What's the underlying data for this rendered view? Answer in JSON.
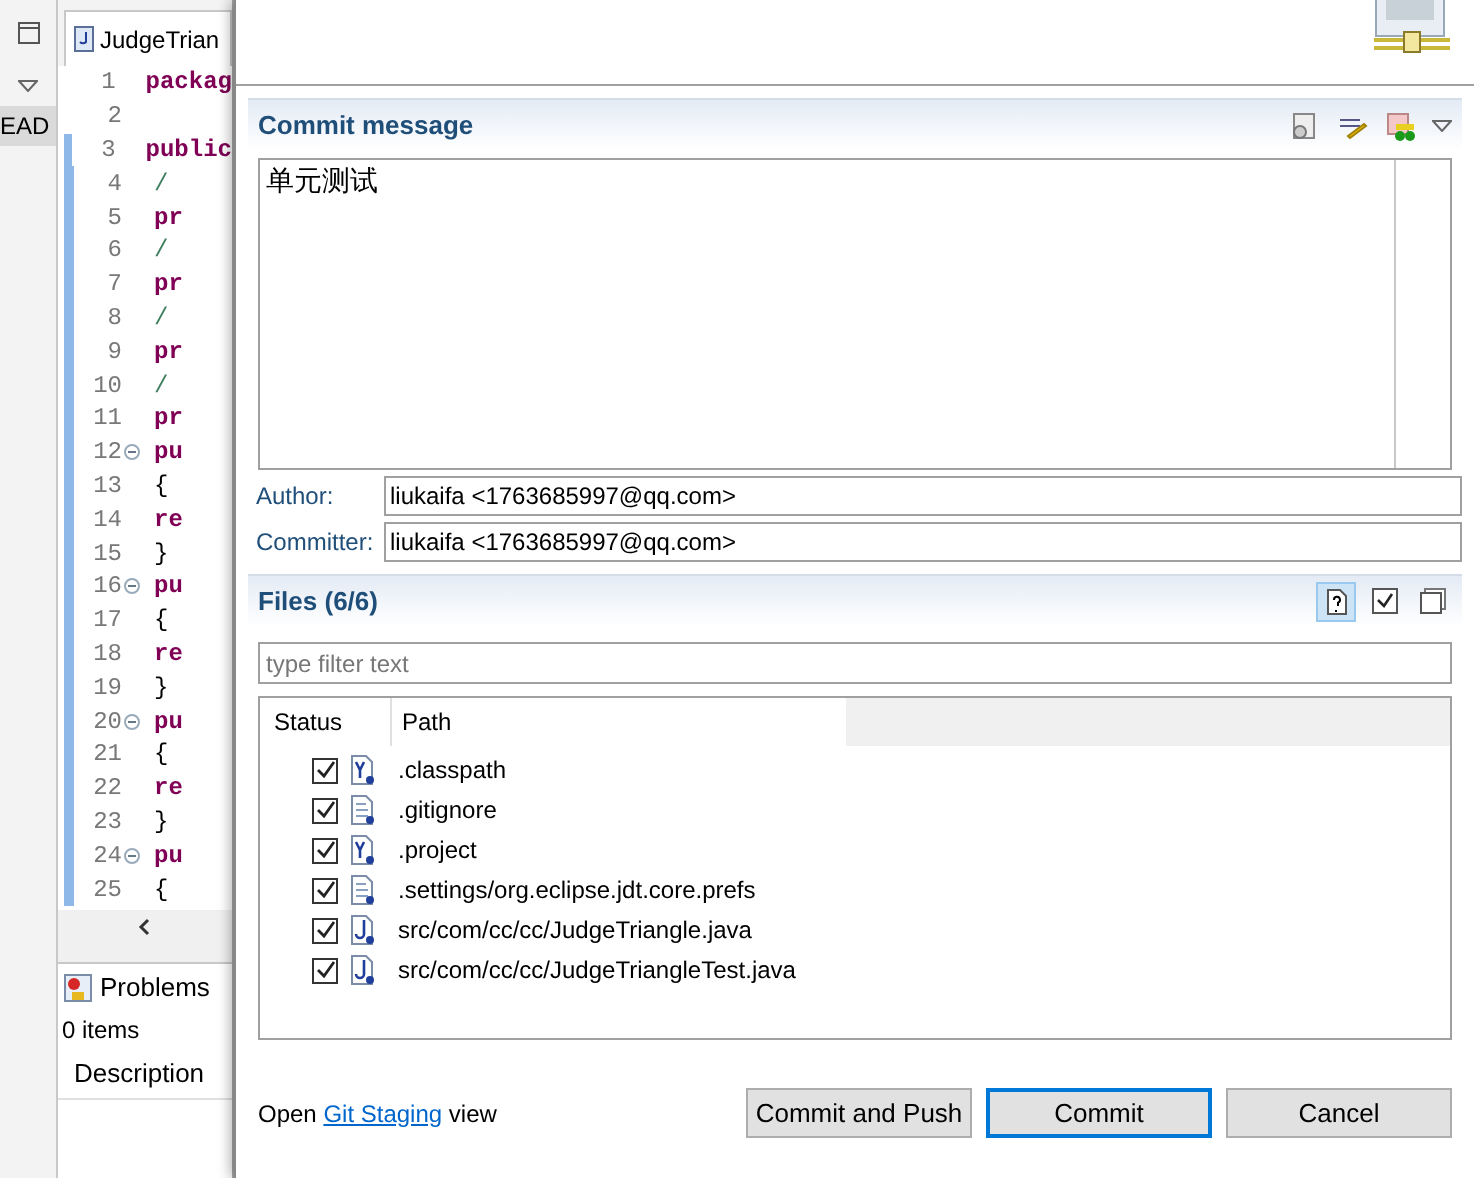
{
  "side_view": {
    "item": "EAD"
  },
  "editor": {
    "tab": "JudgeTrian",
    "lines": [
      {
        "number": "1",
        "code": "packag",
        "kind": "keyword",
        "changed": false,
        "foldable": false
      },
      {
        "number": "2",
        "changed": false,
        "foldable": false
      },
      {
        "number": "3",
        "code": "public",
        "kind": "keyword",
        "changed": true,
        "foldable": false
      },
      {
        "number": "4",
        "code": "/",
        "kind": "comment",
        "changed": true,
        "foldable": false
      },
      {
        "number": "5",
        "code": "pr",
        "kind": "keyword",
        "changed": true,
        "foldable": false
      },
      {
        "number": "6",
        "code": "/",
        "kind": "comment",
        "changed": true,
        "foldable": false
      },
      {
        "number": "7",
        "code": "pr",
        "kind": "keyword",
        "changed": true,
        "foldable": false
      },
      {
        "number": "8",
        "code": "/",
        "kind": "comment",
        "changed": true,
        "foldable": false
      },
      {
        "number": "9",
        "code": "pr",
        "kind": "keyword",
        "changed": true,
        "foldable": false
      },
      {
        "number": "10",
        "code": "/",
        "kind": "comment",
        "changed": true,
        "foldable": false
      },
      {
        "number": "11",
        "code": "pr",
        "kind": "keyword",
        "changed": true,
        "foldable": false
      },
      {
        "number": "12",
        "code": "pu",
        "kind": "keyword",
        "changed": true,
        "foldable": true
      },
      {
        "number": "13",
        "code": "{",
        "kind": "plain",
        "changed": true,
        "foldable": false
      },
      {
        "number": "14",
        "code": "re",
        "kind": "keyword",
        "changed": true,
        "foldable": false
      },
      {
        "number": "15",
        "code": "}",
        "kind": "plain",
        "changed": true,
        "foldable": false
      },
      {
        "number": "16",
        "code": "pu",
        "kind": "keyword",
        "changed": true,
        "foldable": true
      },
      {
        "number": "17",
        "code": "{",
        "kind": "plain",
        "changed": true,
        "foldable": false
      },
      {
        "number": "18",
        "code": "re",
        "kind": "keyword",
        "changed": true,
        "foldable": false
      },
      {
        "number": "19",
        "code": "}",
        "kind": "plain",
        "changed": true,
        "foldable": false
      },
      {
        "number": "20",
        "code": "pu",
        "kind": "keyword",
        "changed": true,
        "foldable": true
      },
      {
        "number": "21",
        "code": "{",
        "kind": "plain",
        "changed": true,
        "foldable": false
      },
      {
        "number": "22",
        "code": "re",
        "kind": "keyword",
        "changed": true,
        "foldable": false
      },
      {
        "number": "23",
        "code": "}",
        "kind": "plain",
        "changed": true,
        "foldable": false
      },
      {
        "number": "24",
        "code": "pu",
        "kind": "keyword",
        "changed": true,
        "foldable": true
      },
      {
        "number": "25",
        "code": "{",
        "kind": "plain",
        "changed": true,
        "foldable": false
      }
    ]
  },
  "problems": {
    "title": "Problems",
    "count": "0 items",
    "column": "Description"
  },
  "dialog": {
    "commit_message": {
      "title": "Commit message",
      "text": "单元测试"
    },
    "author": {
      "label": "Author:",
      "value": "liukaifa <1763685997@qq.com>"
    },
    "committer": {
      "label": "Committer:",
      "value": "liukaifa <1763685997@qq.com>"
    },
    "files": {
      "title": "Files (6/6)",
      "toolbar": [
        {
          "selected": true
        },
        {
          "selected": false
        },
        {
          "selected": false
        }
      ],
      "filter": {
        "placeholder": "type filter text"
      },
      "columns": [
        "Status",
        "Path"
      ],
      "rows": [
        {
          "checked": true,
          "kind": "xml",
          "path": ".classpath"
        },
        {
          "checked": true,
          "kind": "text",
          "path": ".gitignore"
        },
        {
          "checked": true,
          "kind": "xml",
          "path": ".project"
        },
        {
          "checked": true,
          "kind": "text",
          "path": ".settings/org.eclipse.jdt.core.prefs"
        },
        {
          "checked": true,
          "kind": "java",
          "path": "src/com/cc/cc/JudgeTriangle.java"
        },
        {
          "checked": true,
          "kind": "java",
          "path": "src/com/cc/cc/JudgeTriangleTest.java"
        }
      ]
    },
    "footer": {
      "prefix": "Open",
      "link": "Git Staging",
      "suffix": "view"
    },
    "buttons": [
      {
        "label": "Commit and Push",
        "default": false
      },
      {
        "label": "Commit",
        "default": true
      },
      {
        "label": "Cancel",
        "default": false
      }
    ]
  }
}
